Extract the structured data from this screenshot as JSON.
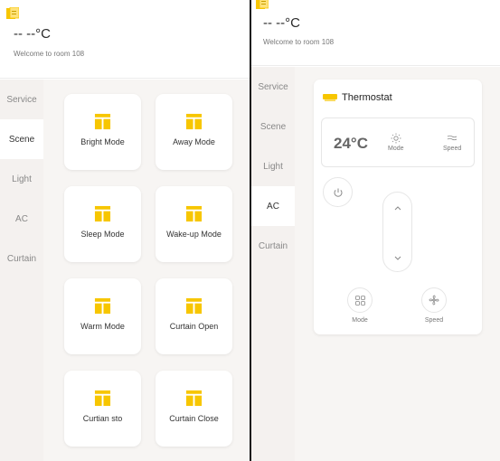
{
  "app": {
    "temperature": "-- --°C",
    "welcome": "Welcome to room 108"
  },
  "colors": {
    "accent": "#F7C600",
    "sidebar_bg": "#f4f1ef",
    "content_bg": "#f7f5f3"
  },
  "left_screen": {
    "sidebar": [
      {
        "label": "Service",
        "active": false
      },
      {
        "label": "Scene",
        "active": true
      },
      {
        "label": "Light",
        "active": false
      },
      {
        "label": "AC",
        "active": false
      },
      {
        "label": "Curtain",
        "active": false
      }
    ],
    "scenes": [
      {
        "label": "Bright Mode",
        "icon": "scene-icon"
      },
      {
        "label": "Away Mode",
        "icon": "scene-icon"
      },
      {
        "label": "Sleep Mode",
        "icon": "scene-icon"
      },
      {
        "label": "Wake-up Mode",
        "icon": "scene-icon"
      },
      {
        "label": "Warm Mode",
        "icon": "scene-icon"
      },
      {
        "label": "Curtain Open",
        "icon": "scene-icon"
      },
      {
        "label": "Curtian sto",
        "icon": "scene-icon"
      },
      {
        "label": "Curtain Close",
        "icon": "scene-icon"
      }
    ]
  },
  "right_screen": {
    "sidebar": [
      {
        "label": "Service",
        "active": false
      },
      {
        "label": "Scene",
        "active": false
      },
      {
        "label": "Light",
        "active": false
      },
      {
        "label": "AC",
        "active": true
      },
      {
        "label": "Curtain",
        "active": false
      }
    ],
    "thermostat": {
      "title": "Thermostat",
      "temperature": "24°C",
      "mode_label": "Mode",
      "speed_label": "Speed",
      "mode_button_label": "Mode",
      "speed_button_label": "Speed"
    }
  }
}
